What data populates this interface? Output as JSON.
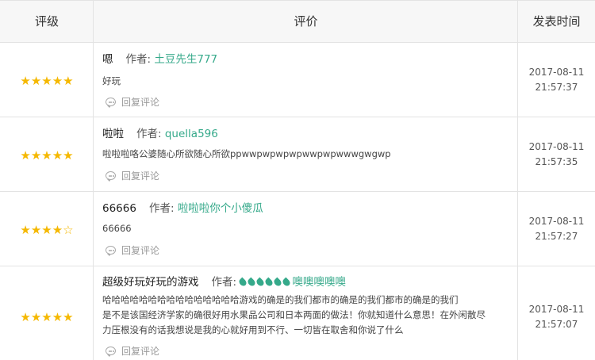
{
  "header": {
    "rating": "评级",
    "review": "评价",
    "time": "发表时间"
  },
  "rows": [
    {
      "stars": 5,
      "title": "嗯",
      "author_label": "作者:",
      "author": "土豆先生777",
      "body": "好玩",
      "reply": "回复评论",
      "date": "2017-08-11",
      "clock": "21:57:37"
    },
    {
      "stars": 5,
      "title": "啦啦",
      "author_label": "作者:",
      "author": "quella596",
      "body": "啦啦啦咯公婆随心所欲随心所欲ppwwpwpwpwpwwpwpwwwgwgwp",
      "reply": "回复评论",
      "date": "2017-08-11",
      "clock": "21:57:35"
    },
    {
      "stars": 4,
      "title": "66666",
      "author_label": "作者:",
      "author": "啦啦啦你个小傻瓜",
      "body": "66666",
      "reply": "回复评论",
      "date": "2017-08-11",
      "clock": "21:57:27"
    },
    {
      "stars": 5,
      "title": "超级好玩好玩的游戏",
      "author_label": "作者:",
      "author": "噢噢噢噢噢",
      "body_lines": [
        "哈哈哈哈哈哈哈哈哈哈哈哈哈哈哈游戏的确是的我们都市的确是的我们都市的确是的我们",
        "是不是该国经济学家的确很好用水果品公司和日本两面的做法！你就知道什么意思！在外闲散尽",
        "力压根没有的话我想说是我的心就好用到不行、一切皆在取舍和你说了什么"
      ],
      "reply": "回复评论",
      "date": "2017-08-11",
      "clock": "21:57:07"
    }
  ]
}
